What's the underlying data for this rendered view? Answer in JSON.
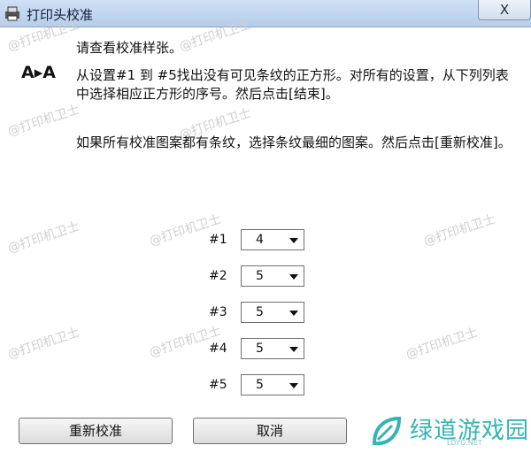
{
  "window": {
    "title": "打印头校准",
    "close_label": "X"
  },
  "icons": {
    "app": "printer-icon",
    "alignment": "alignment-aa-icon",
    "close": "close-icon"
  },
  "content": {
    "heading": "请查看校准样张。",
    "alignment_icon_text": "A▸A",
    "paragraph1": "从设置#1 到 #5找出没有可见条纹的正方形。对所有的设置，从下列列表中选择相应正方形的序号。然后点击[结束]。",
    "paragraph2": "如果所有校准图案都有条纹，选择条纹最细的图案。然后点击[重新校准]。"
  },
  "settings": [
    {
      "label": "#1",
      "value": "4"
    },
    {
      "label": "#2",
      "value": "5"
    },
    {
      "label": "#3",
      "value": "5"
    },
    {
      "label": "#4",
      "value": "5"
    },
    {
      "label": "#5",
      "value": "5"
    }
  ],
  "buttons": {
    "recalibrate": "重新校准",
    "cancel": "取消"
  },
  "watermark": "@打印机卫士",
  "logo": {
    "text": "绿道游戏园",
    "sub": "LDYG.NET",
    "color": "#36b3b3"
  }
}
